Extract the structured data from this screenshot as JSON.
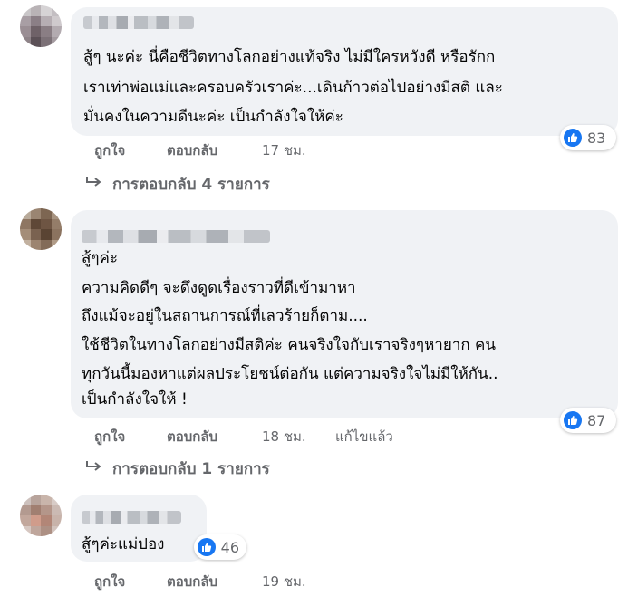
{
  "comments": [
    {
      "text_lines": [
        "สู้ๆ นะค่ะ นี่คือชีวิตทางโลกอย่างแท้จริง ไม่มีใครหวังดี หรือรักก",
        "เราเท่าพ่อแม่และครอบครัวเราค่ะ...เดินก้าวต่อไปอย่างมีสติ และ",
        "มั่นคงในความดีนะค่ะ เป็นกำลังใจให้ค่ะ"
      ],
      "like_label": "ถูกใจ",
      "reply_label": "ตอบกลับ",
      "time": "17 ชม.",
      "reaction_count": "83",
      "replies_label": "การตอบกลับ 4 รายการ"
    },
    {
      "text_lines": [
        "สู้ๆค่ะ",
        "ความคิดดีๆ จะดึงดูดเรื่องราวที่ดีเข้ามาหา",
        "ถึงแม้จะอยู่ในสถานการณ์ที่เลวร้ายก็ตาม....",
        "ใช้ชีวิตในทางโลกอย่างมีสติค่ะ คนจริงใจกับเราจริงๆหายาก คน",
        "ทุกวันนี้มองหาแต่ผลประโยชน์ต่อกัน แต่ความจริงใจไม่มีให้กัน..",
        "เป็นกำลังใจให้ !"
      ],
      "like_label": "ถูกใจ",
      "reply_label": "ตอบกลับ",
      "time": "18 ชม.",
      "edited_label": "แก้ไขแล้ว",
      "reaction_count": "87",
      "replies_label": "การตอบกลับ 1 รายการ"
    },
    {
      "text_lines": [
        "สู้ๆค่ะแม่ปอง"
      ],
      "like_label": "ถูกใจ",
      "reply_label": "ตอบกลับ",
      "time": "19 ชม.",
      "reaction_count": "46"
    }
  ],
  "icons": {
    "reaction": "like-icon",
    "replies": "reply-arrow-icon"
  },
  "colors": {
    "bubble": "#f0f2f5",
    "like": "#1877f2",
    "secondary_text": "#65676b"
  }
}
